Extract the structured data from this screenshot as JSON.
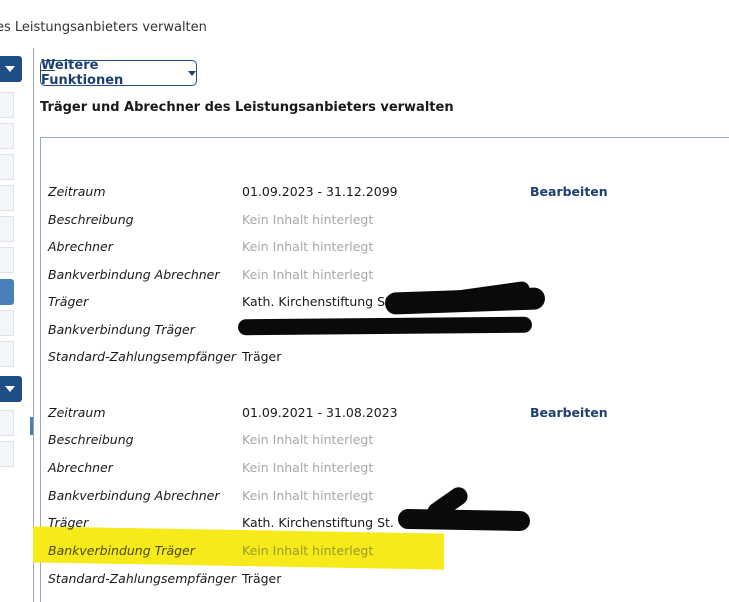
{
  "header": {
    "title": "es Leistungsanbieters verwalten"
  },
  "toolbar": {
    "functions_prefix": "W",
    "functions_rest": "eitere Funktionen"
  },
  "section": {
    "title": "Träger und Abrechner des Leistungsanbieters verwalten"
  },
  "blocks": [
    {
      "rows": [
        {
          "label": "Zeitraum",
          "value": "01.09.2023 - 31.12.2099",
          "empty": false,
          "action": "Bearbeiten"
        },
        {
          "label": "Beschreibung",
          "value": "Kein Inhalt hinterlegt",
          "empty": true
        },
        {
          "label": "Abrechner",
          "value": "Kein Inhalt hinterlegt",
          "empty": true
        },
        {
          "label": "Bankverbindung Abrechner",
          "value": "Kein Inhalt hinterlegt",
          "empty": true
        },
        {
          "label": "Träger",
          "value": "Kath. Kirchenstiftung St.",
          "empty": false
        },
        {
          "label": "Bankverbindung Träger",
          "value": "",
          "empty": false
        },
        {
          "label": "Standard-Zahlungsempfänger",
          "value": "Träger",
          "empty": false
        }
      ]
    },
    {
      "rows": [
        {
          "label": "Zeitraum",
          "value": "01.09.2021 - 31.08.2023",
          "empty": false,
          "action": "Bearbeiten"
        },
        {
          "label": "Beschreibung",
          "value": "Kein Inhalt hinterlegt",
          "empty": true
        },
        {
          "label": "Abrechner",
          "value": "Kein Inhalt hinterlegt",
          "empty": true
        },
        {
          "label": "Bankverbindung Abrechner",
          "value": "Kein Inhalt hinterlegt",
          "empty": true
        },
        {
          "label": "Träger",
          "value": "Kath. Kirchenstiftung St.",
          "empty": false
        },
        {
          "label": "Bankverbindung Träger",
          "value": "Kein Inhalt hinterlegt",
          "empty": true
        },
        {
          "label": "Standard-Zahlungsempfänger",
          "value": "Träger",
          "empty": false
        }
      ]
    }
  ],
  "colors": {
    "accent": "#1d4f86",
    "link": "#1d3f72",
    "empty_text": "#a8a8a8",
    "highlight": "#f7ea1a"
  }
}
